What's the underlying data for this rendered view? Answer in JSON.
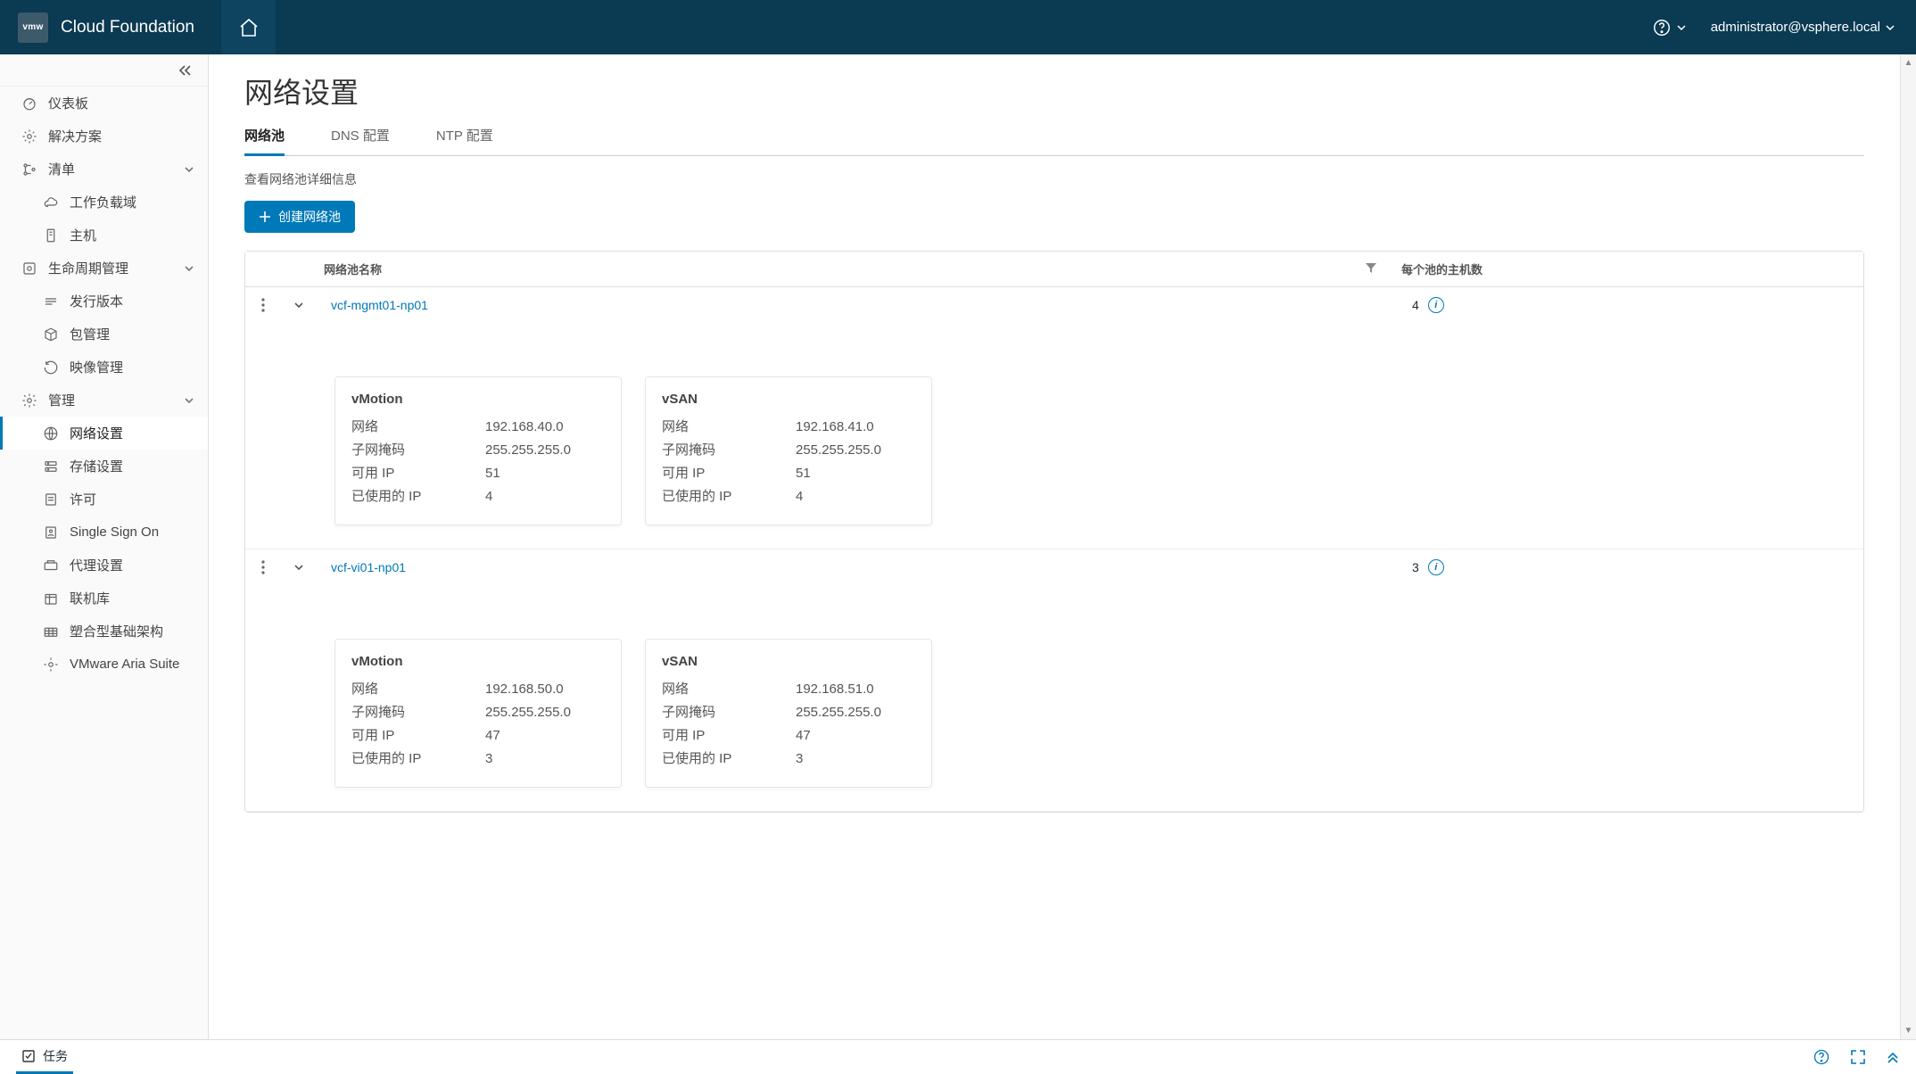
{
  "header": {
    "logo_text": "vmw",
    "product": "Cloud Foundation",
    "user": "administrator@vsphere.local"
  },
  "sidebar": {
    "items": [
      {
        "label": "仪表板",
        "icon": "dashboard",
        "sub": false
      },
      {
        "label": "解决方案",
        "icon": "solutions",
        "sub": false
      },
      {
        "label": "清单",
        "icon": "inventory",
        "sub": false,
        "expandable": true
      },
      {
        "label": "工作负载域",
        "icon": "cloud",
        "sub": true
      },
      {
        "label": "主机",
        "icon": "host",
        "sub": true
      },
      {
        "label": "生命周期管理",
        "icon": "lifecycle",
        "sub": false,
        "expandable": true
      },
      {
        "label": "发行版本",
        "icon": "release",
        "sub": true
      },
      {
        "label": "包管理",
        "icon": "package",
        "sub": true
      },
      {
        "label": "映像管理",
        "icon": "image",
        "sub": true
      },
      {
        "label": "管理",
        "icon": "admin",
        "sub": false,
        "expandable": true
      },
      {
        "label": "网络设置",
        "icon": "network",
        "sub": true,
        "selected": true
      },
      {
        "label": "存储设置",
        "icon": "storage",
        "sub": true
      },
      {
        "label": "许可",
        "icon": "license",
        "sub": true
      },
      {
        "label": "Single Sign On",
        "icon": "sso",
        "sub": true
      },
      {
        "label": "代理设置",
        "icon": "proxy",
        "sub": true
      },
      {
        "label": "联机库",
        "icon": "depot",
        "sub": true
      },
      {
        "label": "塑合型基础架构",
        "icon": "composable",
        "sub": true
      },
      {
        "label": "VMware Aria Suite",
        "icon": "aria",
        "sub": true
      }
    ]
  },
  "page": {
    "title": "网络设置",
    "tabs": [
      "网络池",
      "DNS 配置",
      "NTP 配置"
    ],
    "active_tab": 0,
    "subhead": "查看网络池详细信息",
    "create_btn": "创建网络池",
    "columns": {
      "name": "网络池名称",
      "hosts": "每个池的主机数"
    }
  },
  "pools": [
    {
      "name": "vcf-mgmt01-np01",
      "host_count": "4",
      "nets": [
        {
          "title": "vMotion",
          "network": "192.168.40.0",
          "mask": "255.255.255.0",
          "available": "51",
          "used": "4"
        },
        {
          "title": "vSAN",
          "network": "192.168.41.0",
          "mask": "255.255.255.0",
          "available": "51",
          "used": "4"
        }
      ]
    },
    {
      "name": "vcf-vi01-np01",
      "host_count": "3",
      "nets": [
        {
          "title": "vMotion",
          "network": "192.168.50.0",
          "mask": "255.255.255.0",
          "available": "47",
          "used": "3"
        },
        {
          "title": "vSAN",
          "network": "192.168.51.0",
          "mask": "255.255.255.0",
          "available": "47",
          "used": "3"
        }
      ]
    }
  ],
  "labels": {
    "network": "网络",
    "mask": "子网掩码",
    "available": "可用 IP",
    "used": "已使用的 IP"
  },
  "footer": {
    "tasks": "任务"
  }
}
